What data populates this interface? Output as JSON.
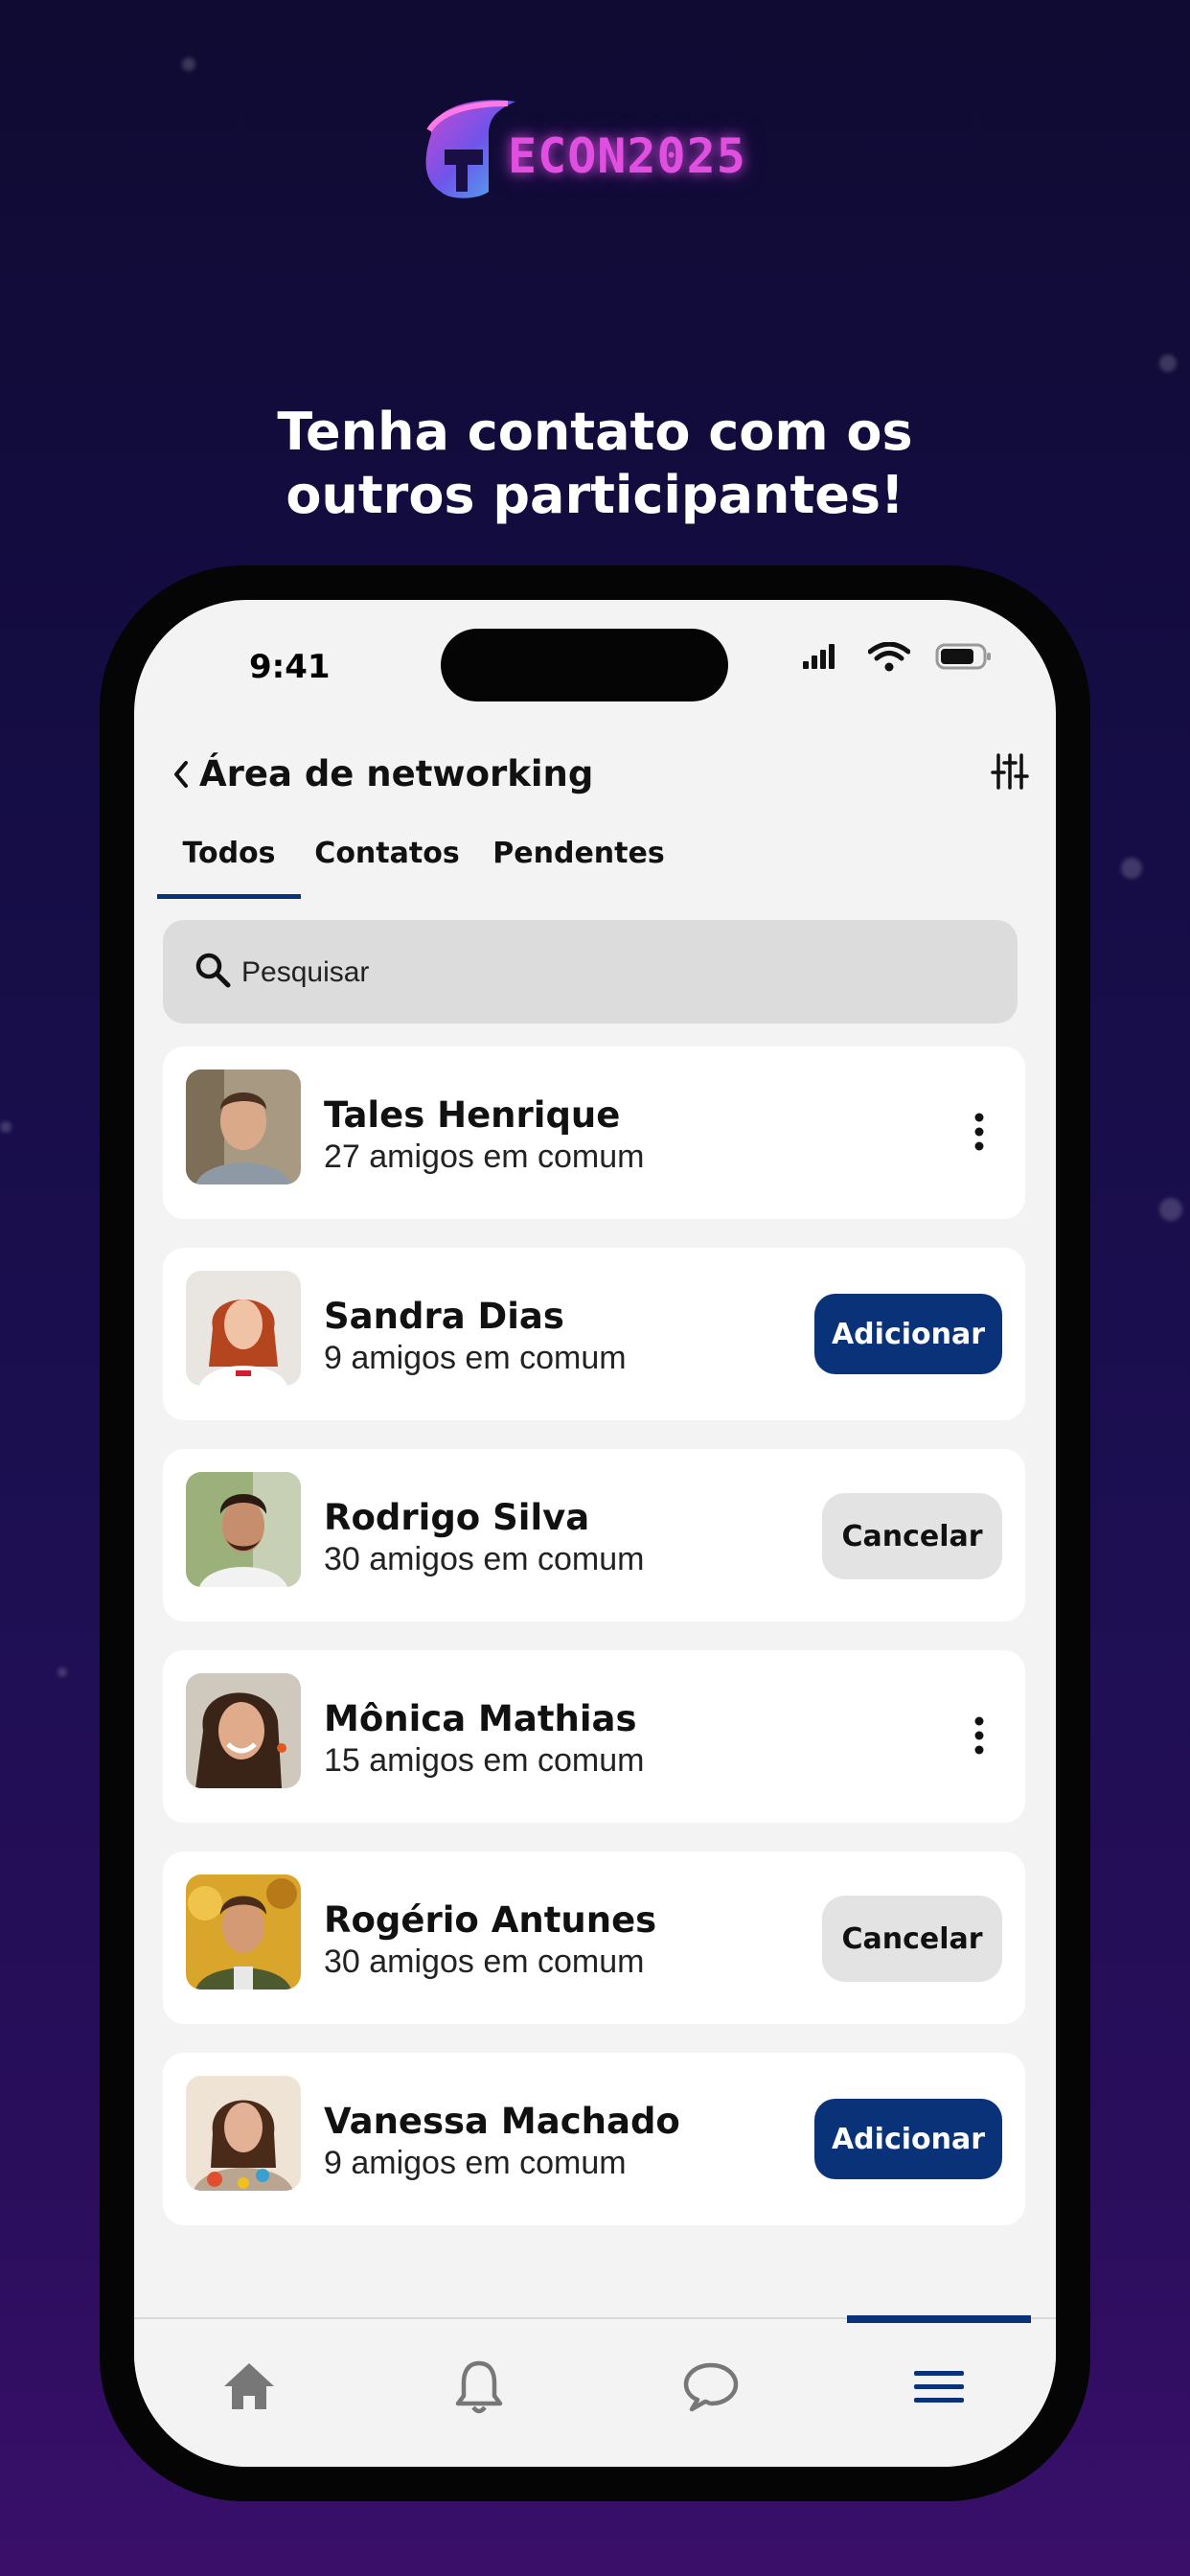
{
  "colors": {
    "accent": "#0a3278",
    "logo": "#e04fe0",
    "background": "#150d45"
  },
  "branding": {
    "logo_text": "ECON2025"
  },
  "headline": {
    "line1": "Tenha contato com os",
    "line2": "outros participantes!"
  },
  "status_bar": {
    "time": "9:41"
  },
  "header": {
    "title": "Área de networking",
    "back_icon": "chevron-left-icon",
    "filter_icon": "sliders-icon"
  },
  "tabs": [
    {
      "label": "Todos",
      "active": true
    },
    {
      "label": "Contatos",
      "active": false
    },
    {
      "label": "Pendentes",
      "active": false
    }
  ],
  "search": {
    "placeholder": "Pesquisar"
  },
  "people": [
    {
      "name": "Tales Henrique",
      "mutual": "27 amigos em comum",
      "action": "menu"
    },
    {
      "name": "Sandra Dias",
      "mutual": "9 amigos em comum",
      "action": "add",
      "action_label": "Adicionar"
    },
    {
      "name": "Rodrigo Silva",
      "mutual": "30 amigos em comum",
      "action": "cancel",
      "action_label": "Cancelar"
    },
    {
      "name": "Mônica Mathias",
      "mutual": "15 amigos em comum",
      "action": "menu"
    },
    {
      "name": "Rogério Antunes",
      "mutual": "30 amigos em comum",
      "action": "cancel",
      "action_label": "Cancelar"
    },
    {
      "name": "Vanessa Machado",
      "mutual": "9 amigos em comum",
      "action": "add",
      "action_label": "Adicionar"
    }
  ],
  "bottom_nav": [
    {
      "icon": "home-icon",
      "active": false
    },
    {
      "icon": "bell-icon",
      "active": false
    },
    {
      "icon": "chat-icon",
      "active": false
    },
    {
      "icon": "menu-icon",
      "active": true
    }
  ]
}
